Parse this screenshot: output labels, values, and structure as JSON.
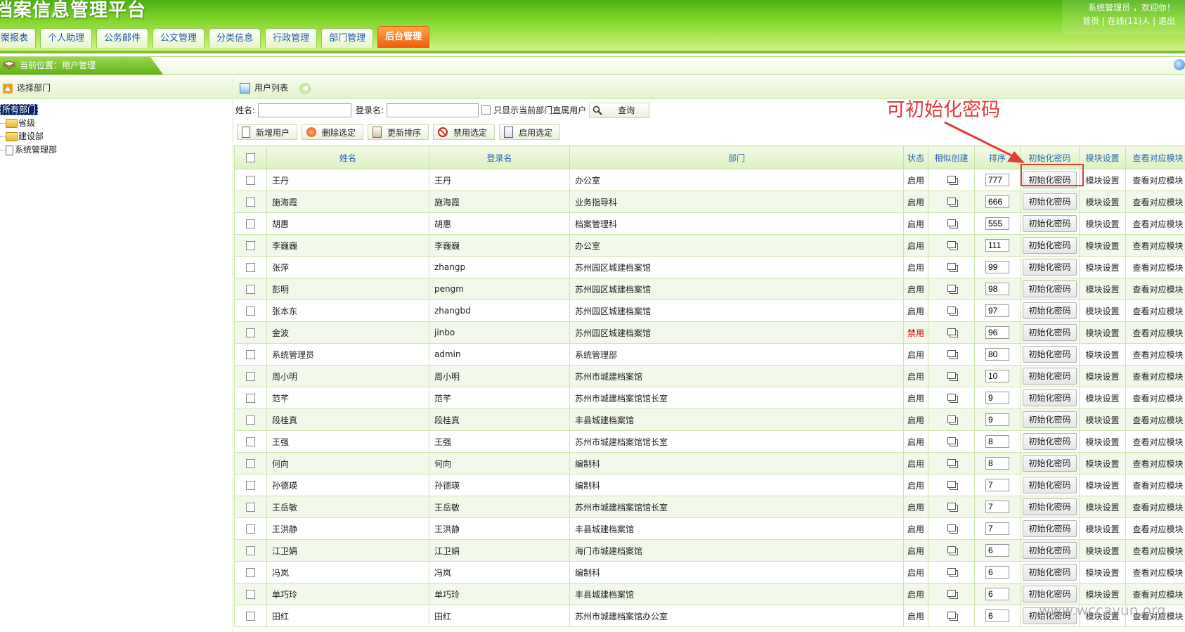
{
  "header": {
    "title": "档案信息管理平台",
    "welcome": "系统管理员 ，欢迎你！",
    "links": {
      "home": "首页",
      "online": "在线(11)人",
      "logout": "退出"
    },
    "tabs": [
      {
        "label": "档案报表"
      },
      {
        "label": "个人助理"
      },
      {
        "label": "公务邮件"
      },
      {
        "label": "公文管理"
      },
      {
        "label": "分类信息"
      },
      {
        "label": "行政管理"
      },
      {
        "label": "部门管理"
      },
      {
        "label": "后台管理",
        "active": true
      }
    ]
  },
  "breadcrumb": {
    "text": "当前位置：用户管理"
  },
  "left": {
    "title": "选择部门",
    "tree": {
      "root": "所有部门",
      "children": [
        "省级",
        "建设部",
        "系统管理部"
      ]
    }
  },
  "right": {
    "title": "用户列表",
    "search": {
      "name_label": "姓名:",
      "login_label": "登录名:",
      "direct_only_label": "只显示当前部门直属用户",
      "query_label": "查询"
    },
    "toolbar": {
      "new": "新增用户",
      "delete": "删除选定",
      "sort": "更新排序",
      "disable": "禁用选定",
      "enable": "启用选定"
    },
    "columns": {
      "name": "姓名",
      "login": "登录名",
      "dept": "部门",
      "status": "状态",
      "similar": "相似创建",
      "order": "排序",
      "init": "初始化密码",
      "module": "模块设置",
      "view": "查看对应模块"
    },
    "rows": [
      {
        "name": "王丹",
        "login": "王丹",
        "dept": "办公室",
        "status": "启用",
        "order": "777",
        "init": "初始化密码",
        "module": "模块设置",
        "view": "查看对应模块"
      },
      {
        "name": "施海霞",
        "login": "施海霞",
        "dept": "业务指导科",
        "status": "启用",
        "order": "666",
        "init": "初始化密码",
        "module": "模块设置",
        "view": "查看对应模块"
      },
      {
        "name": "胡惠",
        "login": "胡惠",
        "dept": "档案管理科",
        "status": "启用",
        "order": "555",
        "init": "初始化密码",
        "module": "模块设置",
        "view": "查看对应模块"
      },
      {
        "name": "李巍巍",
        "login": "李巍巍",
        "dept": "办公室",
        "status": "启用",
        "order": "111",
        "init": "初始化密码",
        "module": "模块设置",
        "view": "查看对应模块"
      },
      {
        "name": "张萍",
        "login": "zhangp",
        "dept": "苏州园区城建档案馆",
        "status": "启用",
        "order": "99",
        "init": "初始化密码",
        "module": "模块设置",
        "view": "查看对应模块"
      },
      {
        "name": "彭明",
        "login": "pengm",
        "dept": "苏州园区城建档案馆",
        "status": "启用",
        "order": "98",
        "init": "初始化密码",
        "module": "模块设置",
        "view": "查看对应模块"
      },
      {
        "name": "张本东",
        "login": "zhangbd",
        "dept": "苏州园区城建档案馆",
        "status": "启用",
        "order": "97",
        "init": "初始化密码",
        "module": "模块设置",
        "view": "查看对应模块"
      },
      {
        "name": "金波",
        "login": "jinbo",
        "dept": "苏州园区城建档案馆",
        "status": "禁用",
        "order": "96",
        "init": "初始化密码",
        "module": "模块设置",
        "view": "查看对应模块"
      },
      {
        "name": "系统管理员",
        "login": "admin",
        "dept": "系统管理部",
        "status": "启用",
        "order": "80",
        "init": "初始化密码",
        "module": "模块设置",
        "view": "查看对应模块"
      },
      {
        "name": "周小明",
        "login": "周小明",
        "dept": "苏州市城建档案馆",
        "status": "启用",
        "order": "10",
        "init": "初始化密码",
        "module": "模块设置",
        "view": "查看对应模块"
      },
      {
        "name": "范芊",
        "login": "范芊",
        "dept": "苏州市城建档案馆馆长室",
        "status": "启用",
        "order": "9",
        "init": "初始化密码",
        "module": "模块设置",
        "view": "查看对应模块"
      },
      {
        "name": "段桂真",
        "login": "段桂真",
        "dept": "丰县城建档案馆",
        "status": "启用",
        "order": "9",
        "init": "初始化密码",
        "module": "模块设置",
        "view": "查看对应模块"
      },
      {
        "name": "王强",
        "login": "王强",
        "dept": "苏州市城建档案馆馆长室",
        "status": "启用",
        "order": "8",
        "init": "初始化密码",
        "module": "模块设置",
        "view": "查看对应模块"
      },
      {
        "name": "何向",
        "login": "何向",
        "dept": "编制科",
        "status": "启用",
        "order": "8",
        "init": "初始化密码",
        "module": "模块设置",
        "view": "查看对应模块"
      },
      {
        "name": "孙德瑛",
        "login": "孙德瑛",
        "dept": "编制科",
        "status": "启用",
        "order": "7",
        "init": "初始化密码",
        "module": "模块设置",
        "view": "查看对应模块"
      },
      {
        "name": "王岳敏",
        "login": "王岳敏",
        "dept": "苏州市城建档案馆馆长室",
        "status": "启用",
        "order": "7",
        "init": "初始化密码",
        "module": "模块设置",
        "view": "查看对应模块"
      },
      {
        "name": "王洪静",
        "login": "王洪静",
        "dept": "丰县城建档案馆",
        "status": "启用",
        "order": "7",
        "init": "初始化密码",
        "module": "模块设置",
        "view": "查看对应模块"
      },
      {
        "name": "江卫娟",
        "login": "江卫娟",
        "dept": "海门市城建档案馆",
        "status": "启用",
        "order": "6",
        "init": "初始化密码",
        "module": "模块设置",
        "view": "查看对应模块"
      },
      {
        "name": "冯岚",
        "login": "冯岚",
        "dept": "编制科",
        "status": "启用",
        "order": "6",
        "init": "初始化密码",
        "module": "模块设置",
        "view": "查看对应模块"
      },
      {
        "name": "单巧玲",
        "login": "单巧玲",
        "dept": "丰县城建档案馆",
        "status": "启用",
        "order": "6",
        "init": "初始化密码",
        "module": "模块设置",
        "view": "查看对应模块"
      },
      {
        "name": "田红",
        "login": "田红",
        "dept": "苏州市城建档案馆办公室",
        "status": "启用",
        "order": "6",
        "init": "初始化密码",
        "module": "模块设置",
        "view": "查看对应模块"
      }
    ]
  },
  "annotation": {
    "text": "可初始化密码",
    "color": "#e33a3a"
  },
  "watermark": {
    "text": "www.wccayun.org"
  },
  "colors": {
    "accent_green": "#7dd42a",
    "active_tab": "#f05a0a",
    "link_blue": "#2a67b5"
  }
}
